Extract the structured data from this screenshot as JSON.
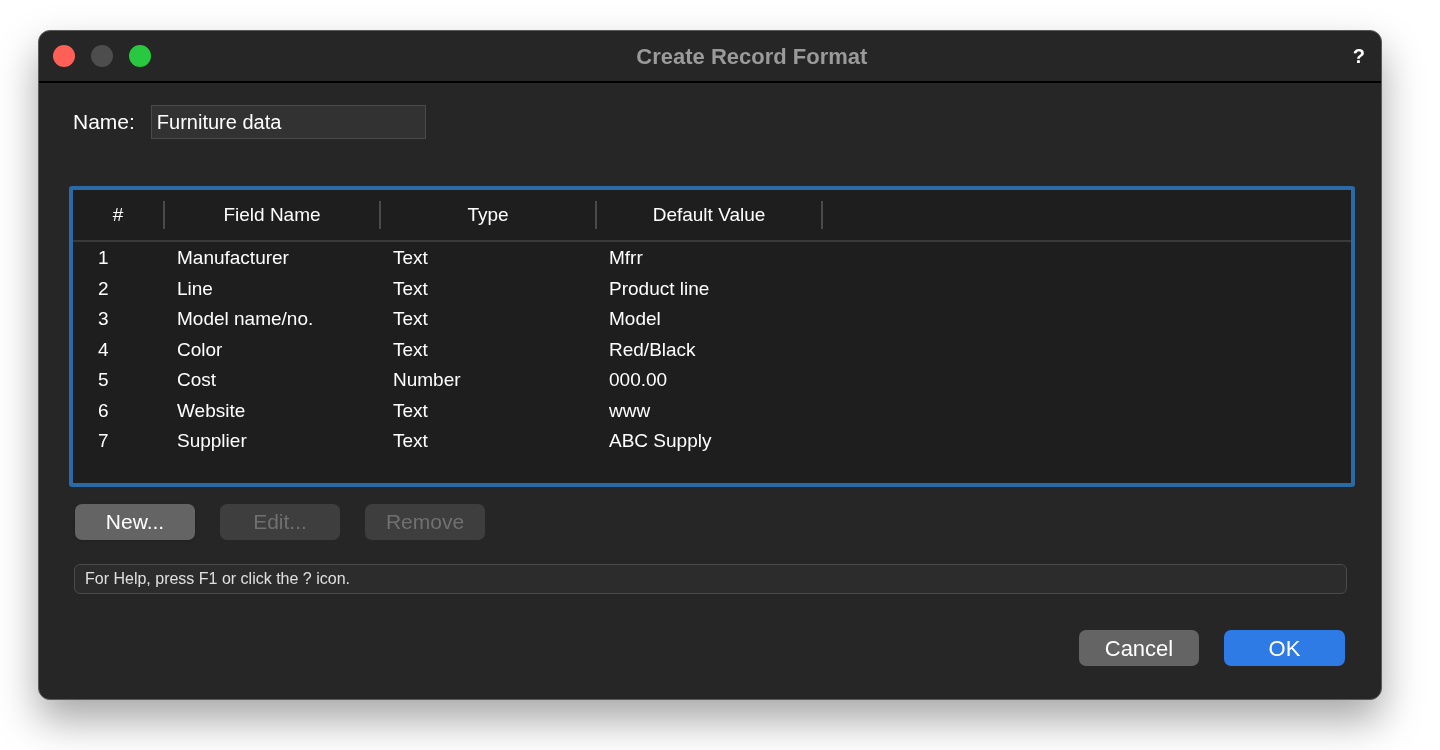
{
  "window": {
    "title": "Create Record Format",
    "help": "?"
  },
  "name_field": {
    "label": "Name:",
    "value": "Furniture data"
  },
  "table": {
    "columns": [
      "#",
      "Field Name",
      "Type",
      "Default Value"
    ],
    "rows": [
      [
        "1",
        "Manufacturer",
        "Text",
        "Mfrr"
      ],
      [
        "2",
        "Line",
        "Text",
        "Product line"
      ],
      [
        "3",
        "Model name/no.",
        "Text",
        "Model"
      ],
      [
        "4",
        "Color",
        "Text",
        "Red/Black"
      ],
      [
        "5",
        "Cost",
        "Number",
        "000.00"
      ],
      [
        "6",
        "Website",
        "Text",
        "www"
      ],
      [
        "7",
        "Supplier",
        "Text",
        "ABC Supply"
      ]
    ]
  },
  "list_buttons": [
    {
      "label": "New...",
      "disabled": false
    },
    {
      "label": "Edit...",
      "disabled": true
    },
    {
      "label": "Remove",
      "disabled": true
    }
  ],
  "status_bar": "For Help, press F1 or click the ? icon.",
  "dialog_buttons": [
    {
      "label": "Cancel",
      "default": false
    },
    {
      "label": "OK",
      "default": true
    }
  ]
}
